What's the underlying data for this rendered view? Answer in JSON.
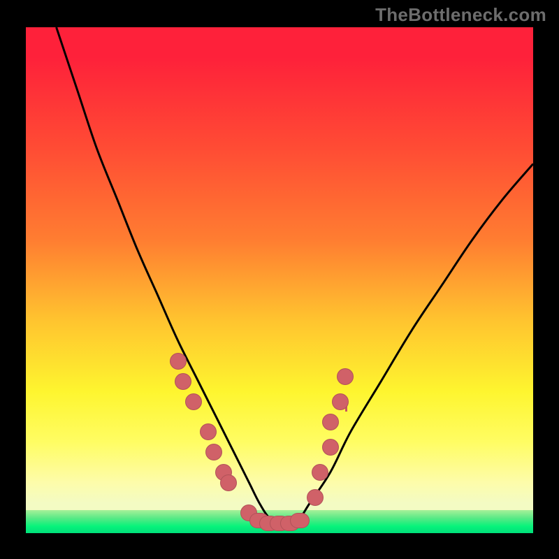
{
  "watermark": "TheBottleneck.com",
  "colors": {
    "accent_dot": "#d06168",
    "curve": "#000000",
    "bg_black": "#000000",
    "grad_top": "#fe213a",
    "grad_mid1": "#ff7d31",
    "grad_mid2": "#fef52f",
    "grad_low": "#fdfcaa",
    "grad_band": "#f3fbc3",
    "grad_green1": "#a7f199",
    "grad_green2": "#08f37b",
    "grad_green3": "#00e07a"
  },
  "chart_data": {
    "type": "line",
    "title": "",
    "xlabel": "",
    "ylabel": "",
    "xlim": [
      0,
      100
    ],
    "ylim": [
      0,
      100
    ],
    "series": [
      {
        "name": "bottleneck-curve",
        "x": [
          6,
          10,
          14,
          18,
          22,
          26,
          30,
          34,
          38,
          42,
          44,
          46,
          48,
          50,
          52,
          54,
          56,
          60,
          64,
          70,
          76,
          82,
          88,
          94,
          100
        ],
        "y": [
          100,
          88,
          76,
          66,
          56,
          47,
          38,
          30,
          22,
          14,
          10,
          6,
          3,
          2,
          2,
          3,
          6,
          12,
          20,
          30,
          40,
          49,
          58,
          66,
          73
        ]
      }
    ],
    "markers": {
      "name": "highlight-points",
      "x": [
        30,
        31,
        33,
        36,
        37,
        39,
        40,
        44,
        46,
        48,
        50,
        52,
        54,
        57,
        58,
        60,
        60,
        62,
        63
      ],
      "y": [
        34,
        30,
        26,
        20,
        16,
        12,
        10,
        4,
        2.5,
        2,
        2,
        2,
        2.5,
        7,
        12,
        17,
        22,
        26,
        31
      ]
    },
    "bottom_band": {
      "start_y_pct": 95.5,
      "end_y_pct": 100
    }
  }
}
